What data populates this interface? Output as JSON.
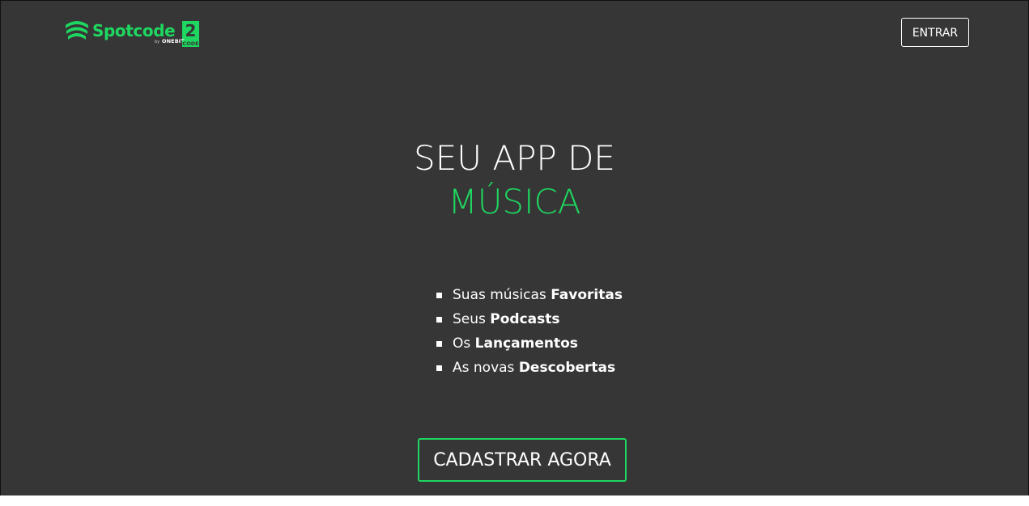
{
  "header": {
    "logo": {
      "name": "Spotcode",
      "number": "2",
      "by": "by",
      "onebit": "ONEBIT",
      "code": "CODE",
      "icon": "spotify-waves-icon"
    },
    "login_button": "ENTRAR"
  },
  "hero": {
    "line1": "SEU APP DE",
    "line2": "MÚSICA"
  },
  "features": [
    {
      "prefix": "Suas músicas ",
      "bold": "Favoritas"
    },
    {
      "prefix": "Seus ",
      "bold": "Podcasts"
    },
    {
      "prefix": "Os ",
      "bold": "Lançamentos"
    },
    {
      "prefix": "As novas ",
      "bold": "Descobertas"
    }
  ],
  "cta_button": "CADASTRAR AGORA",
  "colors": {
    "accent": "#1ed760",
    "background": "#363636",
    "text": "#ffffff"
  }
}
